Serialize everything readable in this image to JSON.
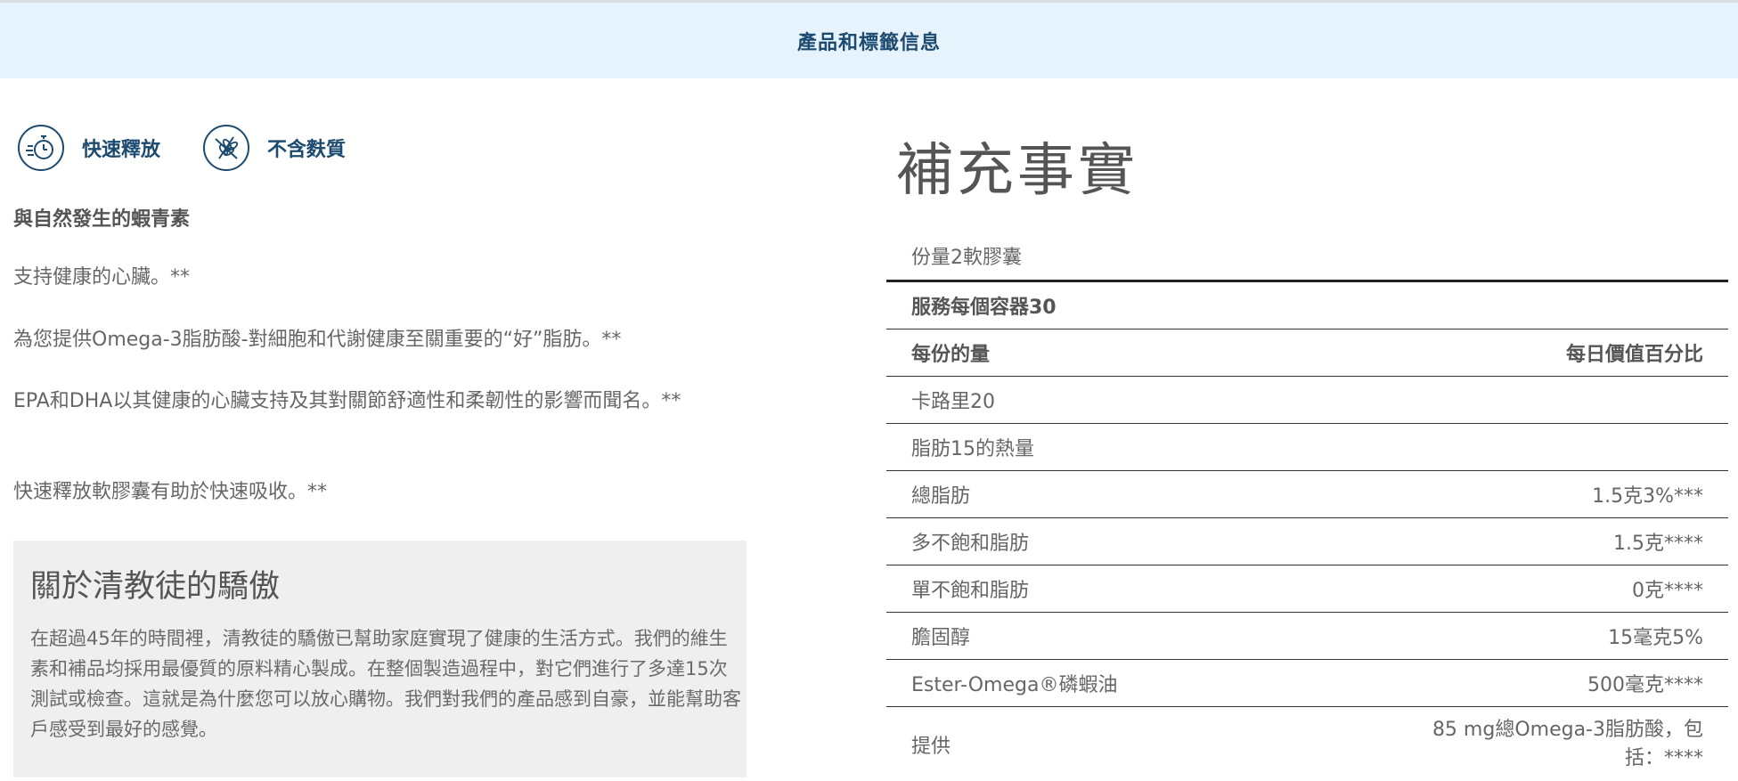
{
  "header": {
    "title": "產品和標籤信息"
  },
  "badges": [
    {
      "icon": "stopwatch-icon",
      "label": "快速釋放"
    },
    {
      "icon": "wheat-crossed-icon",
      "label": "不含麩質"
    }
  ],
  "left": {
    "heading": "與自然發生的蝦青素",
    "bullets": [
      "支持健康的心臟。**",
      "為您提供Omega-3脂肪酸-對細胞和代謝健康至關重要的“好”脂肪。**",
      "EPA和DHA以其健康的心臟支持及其對關節舒適性和柔韌性的影響而聞名。**",
      "快速釋放軟膠囊有助於快速吸收。**"
    ]
  },
  "about": {
    "title": "關於清教徒的驕傲",
    "text": "在超過45年的時間裡，清教徒的驕傲已幫助家庭實現了健康的生活方式。我們的維生素和補品均採用最優質的原料精心製成。在整個製造過程中，對它們進行了多達15次測試或檢查。這就是為什麼您可以放心購物。我們對我們的產品感到自豪，並能幫助客戶感受到最好的感覺。"
  },
  "facts": {
    "title": "補充事實",
    "serving_size": "份量2軟膠囊",
    "servings_per_container": "服務每個容器30",
    "amount_header": "每份的量",
    "dv_header": "每日價值百分比",
    "rows": [
      {
        "name": "卡路里20",
        "value": ""
      },
      {
        "name": "脂肪15的熱量",
        "value": ""
      },
      {
        "name": "總脂肪",
        "value": "1.5克3%***"
      },
      {
        "name": "多不飽和脂肪",
        "value": "1.5克****"
      },
      {
        "name": "單不飽和脂肪",
        "value": "0克****"
      },
      {
        "name": "膽固醇",
        "value": "15毫克5%"
      },
      {
        "name": "Ester-Omega®磷蝦油",
        "value": "500毫克****"
      },
      {
        "name": "提供",
        "value": "85 mg總Omega-3脂肪酸，包括：****"
      }
    ]
  },
  "colors": {
    "header_bg": "#e6f3fc",
    "brand_navy": "#1d4a6f",
    "about_bg": "#efefef"
  }
}
